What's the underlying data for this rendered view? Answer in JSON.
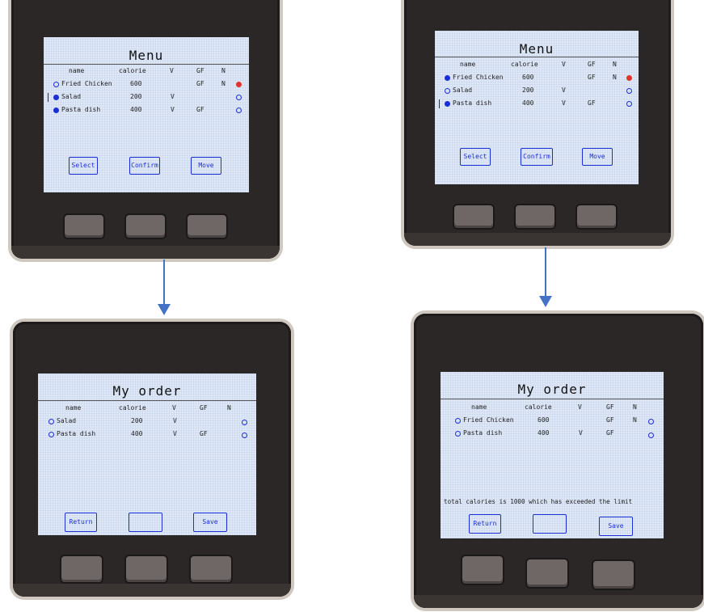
{
  "colors": {
    "accent": "#1b2fd6",
    "selected_red": "#e0342b",
    "arrow": "#4472c4"
  },
  "columns": [
    "name",
    "calorie",
    "V",
    "GF",
    "N"
  ],
  "tl": {
    "title": "Menu",
    "rows": [
      {
        "name": "Fried Chicken",
        "calorie": "600",
        "v": "",
        "gf": "GF",
        "n": "N",
        "left": "open",
        "right": "red",
        "cursor": false
      },
      {
        "name": "Salad",
        "calorie": "200",
        "v": "V",
        "gf": "",
        "n": "",
        "left": "filled",
        "right": "open",
        "cursor": true
      },
      {
        "name": "Pasta dish",
        "calorie": "400",
        "v": "V",
        "gf": "GF",
        "n": "",
        "left": "filled",
        "right": "open",
        "cursor": false
      }
    ],
    "buttons": [
      "Select",
      "Confirm",
      "Move"
    ]
  },
  "tr": {
    "title": "Menu",
    "rows": [
      {
        "name": "Fried Chicken",
        "calorie": "600",
        "v": "",
        "gf": "GF",
        "n": "N",
        "left": "filled",
        "right": "red",
        "cursor": false
      },
      {
        "name": "Salad",
        "calorie": "200",
        "v": "V",
        "gf": "",
        "n": "",
        "left": "open",
        "right": "open",
        "cursor": false
      },
      {
        "name": "Pasta dish",
        "calorie": "400",
        "v": "V",
        "gf": "GF",
        "n": "",
        "left": "filled",
        "right": "open",
        "cursor": true
      }
    ],
    "buttons": [
      "Select",
      "Confirm",
      "Move"
    ]
  },
  "bl": {
    "title": "My order",
    "rows": [
      {
        "name": "Salad",
        "calorie": "200",
        "v": "V",
        "gf": "",
        "n": "",
        "left": "open",
        "right": "open",
        "cursor": false
      },
      {
        "name": "Pasta dish",
        "calorie": "400",
        "v": "V",
        "gf": "GF",
        "n": "",
        "left": "open",
        "right": "open",
        "cursor": false
      }
    ],
    "buttons": [
      "Return",
      "",
      "Save"
    ]
  },
  "br": {
    "title": "My order",
    "rows": [
      {
        "name": "Fried Chicken",
        "calorie": "600",
        "v": "",
        "gf": "GF",
        "n": "N",
        "left": "open",
        "right": "open",
        "cursor": false
      },
      {
        "name": "Pasta dish",
        "calorie": "400",
        "v": "V",
        "gf": "GF",
        "n": "",
        "left": "open",
        "right": "open",
        "cursor": false
      }
    ],
    "buttons": [
      "Return",
      "",
      "Save"
    ],
    "message": "total calories is 1000 which has exceeded the limit"
  }
}
